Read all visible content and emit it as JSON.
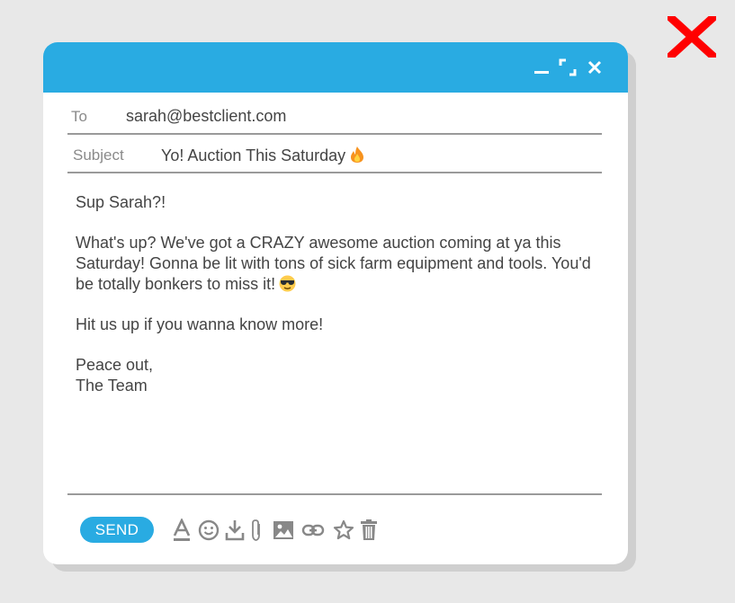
{
  "close_overlay": {
    "icon": "close-x-icon",
    "color": "#ff0000"
  },
  "window": {
    "titlebar_color": "#29abe2",
    "controls": [
      "minimize-icon",
      "maximize-icon",
      "close-icon"
    ]
  },
  "compose": {
    "to_label": "To",
    "to_value": "sarah@bestclient.com",
    "subject_label": "Subject",
    "subject_value": "Yo! Auction This Saturday",
    "subject_emoji": "fire-emoji-icon",
    "body": {
      "greeting": "Sup Sarah?!",
      "paragraph": "What's up? We've got a CRAZY awesome auction coming at ya this Saturday! Gonna be lit with tons of sick farm equipment and tools. You'd be totally bonkers to miss it!",
      "paragraph_emoji": "sunglasses-emoji-icon",
      "cta": "Hit us up if you wanna know more!",
      "signoff": "Peace out,",
      "signature": "The Team"
    }
  },
  "toolbar": {
    "send_label": "SEND",
    "tools": [
      "text-format-icon",
      "emoji-icon",
      "download-icon",
      "attachment-icon",
      "image-icon",
      "link-icon",
      "star-icon",
      "trash-icon"
    ]
  }
}
